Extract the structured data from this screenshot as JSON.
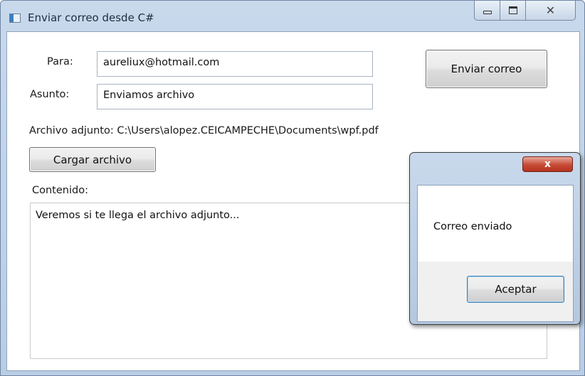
{
  "window": {
    "title": "Enviar correo desde C#",
    "close_glyph": "✕"
  },
  "form": {
    "para_label": "Para:",
    "para_value": "aureliux@hotmail.com",
    "asunto_label": "Asunto:",
    "asunto_value": "Enviamos archivo",
    "send_button": "Enviar correo",
    "attachment_text": "Archivo adjunto: C:\\Users\\alopez.CEICAMPECHE\\Documents\\wpf.pdf",
    "load_button": "Cargar archivo",
    "content_label": "Contenido:",
    "content_value": "Veremos si te llega el archivo adjunto..."
  },
  "dialog": {
    "close_glyph": "x",
    "message": "Correo enviado",
    "ok_button": "Aceptar"
  },
  "icons": {
    "app": "window-icon",
    "minimize": "minimize-icon",
    "maximize": "maximize-icon",
    "close": "close-icon"
  }
}
